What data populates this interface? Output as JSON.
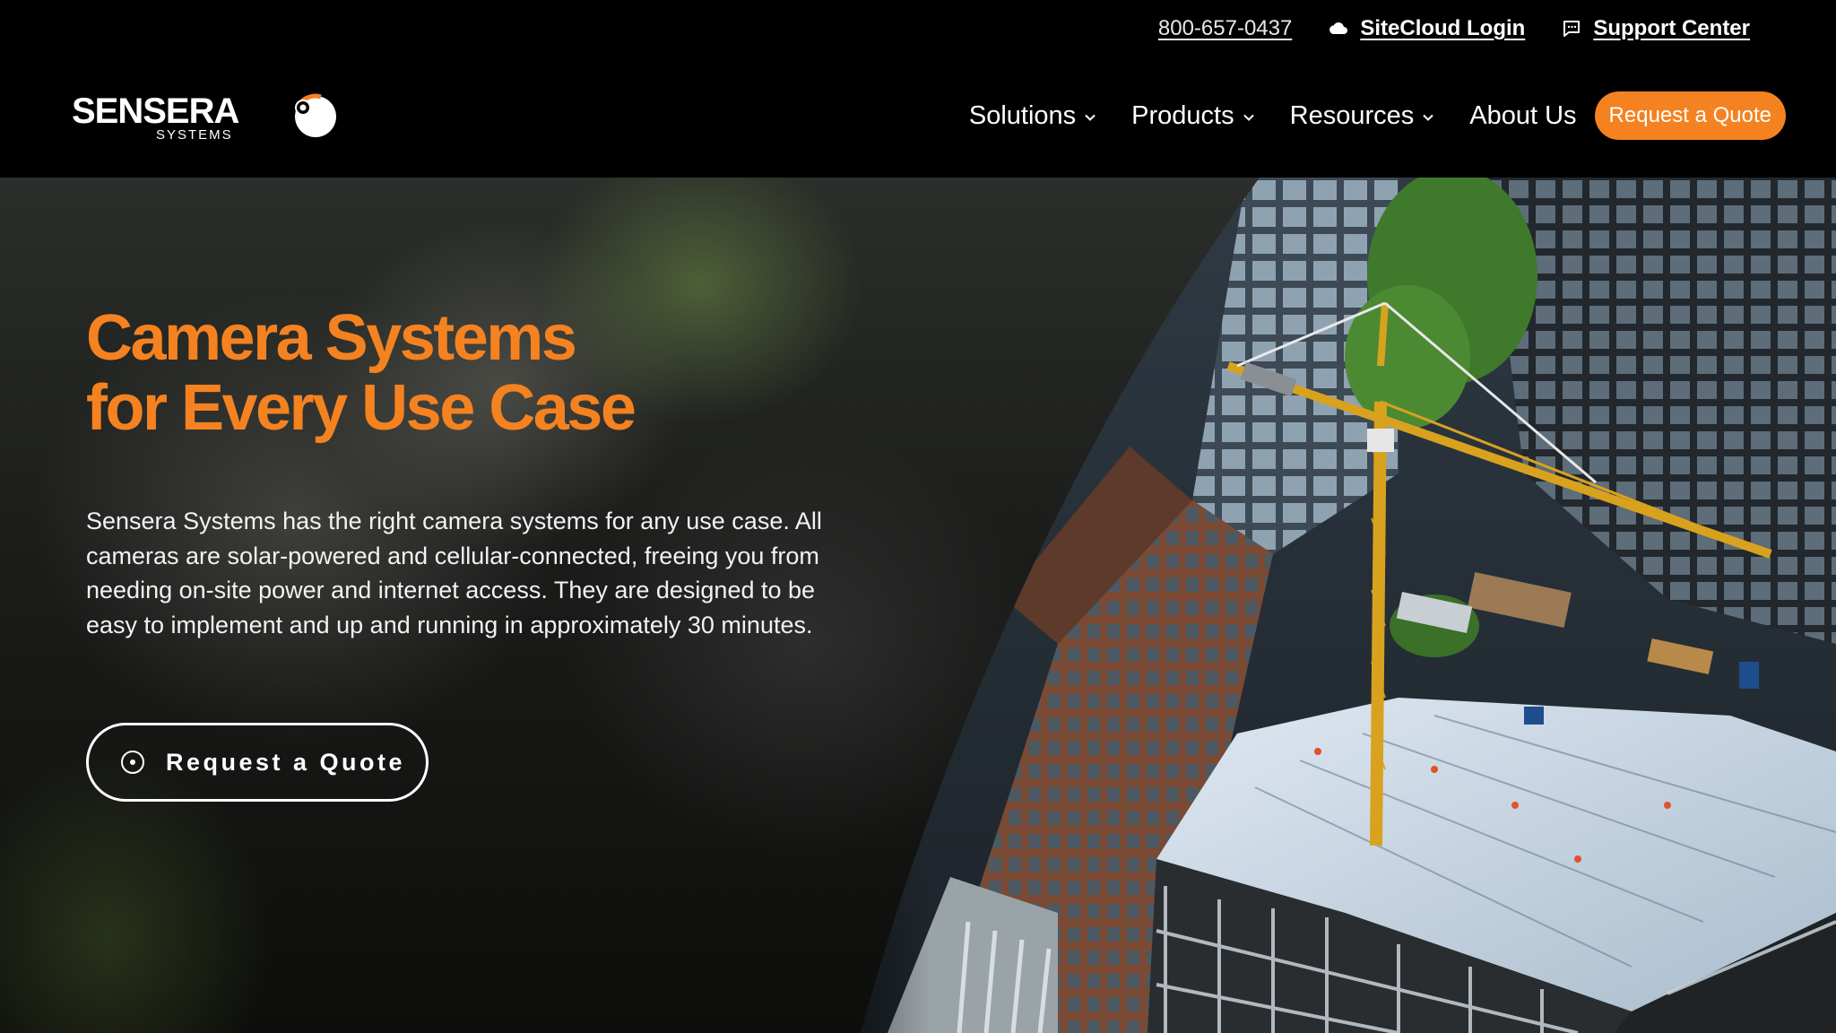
{
  "utility": {
    "phone": "800-657-0437",
    "sitecloud_login": "SiteCloud Login",
    "support_center": "Support Center",
    "sitecloud_icon": "cloud-icon",
    "support_icon": "chat-bubble-icon"
  },
  "brand": {
    "name": "SENSERA",
    "subtitle": "SYSTEMS",
    "accent_color": "#f58220"
  },
  "nav": {
    "items": [
      {
        "label": "Solutions",
        "has_dropdown": true
      },
      {
        "label": "Products",
        "has_dropdown": true
      },
      {
        "label": "Resources",
        "has_dropdown": true
      },
      {
        "label": "About Us",
        "has_dropdown": false
      }
    ],
    "quote_button": "Request a Quote"
  },
  "hero": {
    "title_line1": "Camera Systems",
    "title_line2": "for Every Use Case",
    "body": "Sensera Systems has the right camera systems for any use case. All cameras are solar-powered and cellular-connected, freeing you from needing on-site power and internet access. They are designed to be easy to implement and up and running in approximately 30 minutes.",
    "cta_label": "Request a Quote",
    "cta_icon": "target-circle-icon",
    "image_subject": "aerial view of high-rise construction site with tower crane"
  }
}
